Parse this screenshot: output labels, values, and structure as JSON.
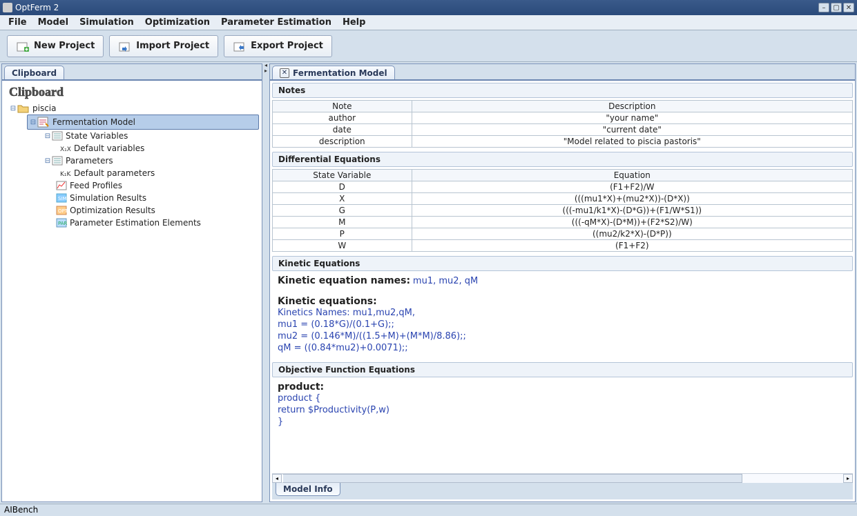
{
  "window": {
    "title": "OptFerm 2"
  },
  "menubar": [
    "File",
    "Model",
    "Simulation",
    "Optimization",
    "Parameter Estimation",
    "Help"
  ],
  "toolbar": {
    "new_project": "New Project",
    "import_project": "Import Project",
    "export_project": "Export Project"
  },
  "sidebar": {
    "tab": "Clipboard",
    "heading": "Clipboard",
    "project": "piscia",
    "model": "Fermentation Model",
    "state_variables": "State Variables",
    "default_variables": "Default variables",
    "parameters": "Parameters",
    "default_parameters": "Default parameters",
    "feed_profiles": "Feed Profiles",
    "simulation_results": "Simulation Results",
    "optimization_results": "Optimization Results",
    "param_est_elements": "Parameter Estimation Elements"
  },
  "content": {
    "tab": "Fermentation Model",
    "notes_header": "Notes",
    "notes_cols": {
      "note": "Note",
      "description": "Description"
    },
    "notes": [
      {
        "note": "author",
        "desc": "\"your name\""
      },
      {
        "note": "date",
        "desc": "\"current date\""
      },
      {
        "note": "description",
        "desc": "\"Model related to piscia pastoris\""
      }
    ],
    "diffeq_header": "Differential Equations",
    "diffeq_cols": {
      "var": "State Variable",
      "eq": "Equation"
    },
    "diffeq": [
      {
        "var": "D",
        "eq": "(F1+F2)/W"
      },
      {
        "var": "X",
        "eq": "(((mu1*X)+(mu2*X))-(D*X))"
      },
      {
        "var": "G",
        "eq": "(((-mu1/k1*X)-(D*G))+(F1/W*S1))"
      },
      {
        "var": "M",
        "eq": "(((-qM*X)-(D*M))+(F2*S2)/W)"
      },
      {
        "var": "P",
        "eq": "((mu2/k2*X)-(D*P))"
      },
      {
        "var": "W",
        "eq": "(F1+F2)"
      }
    ],
    "kinetic_header": "Kinetic Equations",
    "kin_names_label": "Kinetic equation names:",
    "kin_names": "mu1, mu2, qM",
    "kin_eq_label": "Kinetic equations:",
    "kin_lines": [
      "Kinetics Names: mu1,mu2,qM,",
      "mu1 = (0.18*G)/(0.1+G);;",
      "mu2 = (0.146*M)/((1.5+M)+(M*M)/8.86);;",
      "qM = ((0.84*mu2)+0.0071);;"
    ],
    "objfn_header": "Objective Function Equations",
    "objfn_label": "product:",
    "objfn_lines": [
      "product    {",
      "return $Productivity(P,w)",
      "}"
    ],
    "bottom_tab": "Model Info"
  },
  "statusbar": "AIBench"
}
